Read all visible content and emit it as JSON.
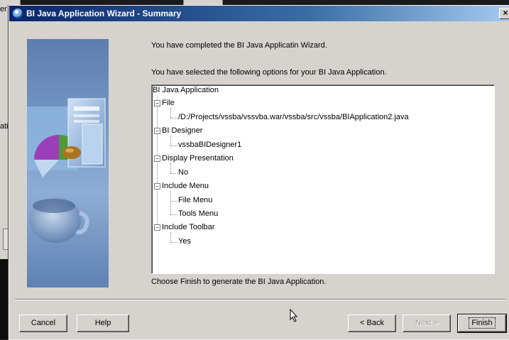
{
  "background": {
    "fragment_1": "er",
    "fragment_2": "ati"
  },
  "dialog": {
    "title": "BI Java Application Wizard - Summary",
    "close_label": "×"
  },
  "summary": {
    "completed_text": "You have completed the BI Java Applicatin Wizard.",
    "selected_text": "You have selected the following options for your BI Java Application.",
    "finish_note": "Choose Finish to generate the BI Java Application."
  },
  "tree": {
    "root": "BI Java Application",
    "file_label": "File",
    "file_value": "/D:/Projects/vssba/vssvba.war/vssba/src/vssba/BIApplication2.java",
    "designer_label": "BI Designer",
    "designer_value": "vssbaBIDesigner1",
    "display_label": "Display Presentation",
    "display_value": "No",
    "menu_label": "Include Menu",
    "menu_item_1": "File Menu",
    "menu_item_2": "Tools Menu",
    "toolbar_label": "Include Toolbar",
    "toolbar_value": "Yes",
    "toggle_symbol": "−"
  },
  "buttons": {
    "cancel": "Cancel",
    "help": "Help",
    "back": "< Back",
    "next": "Next >",
    "finish": "Finish"
  },
  "icons": {
    "title": "java-cup-icon",
    "cursor": "mouse-pointer-icon"
  }
}
